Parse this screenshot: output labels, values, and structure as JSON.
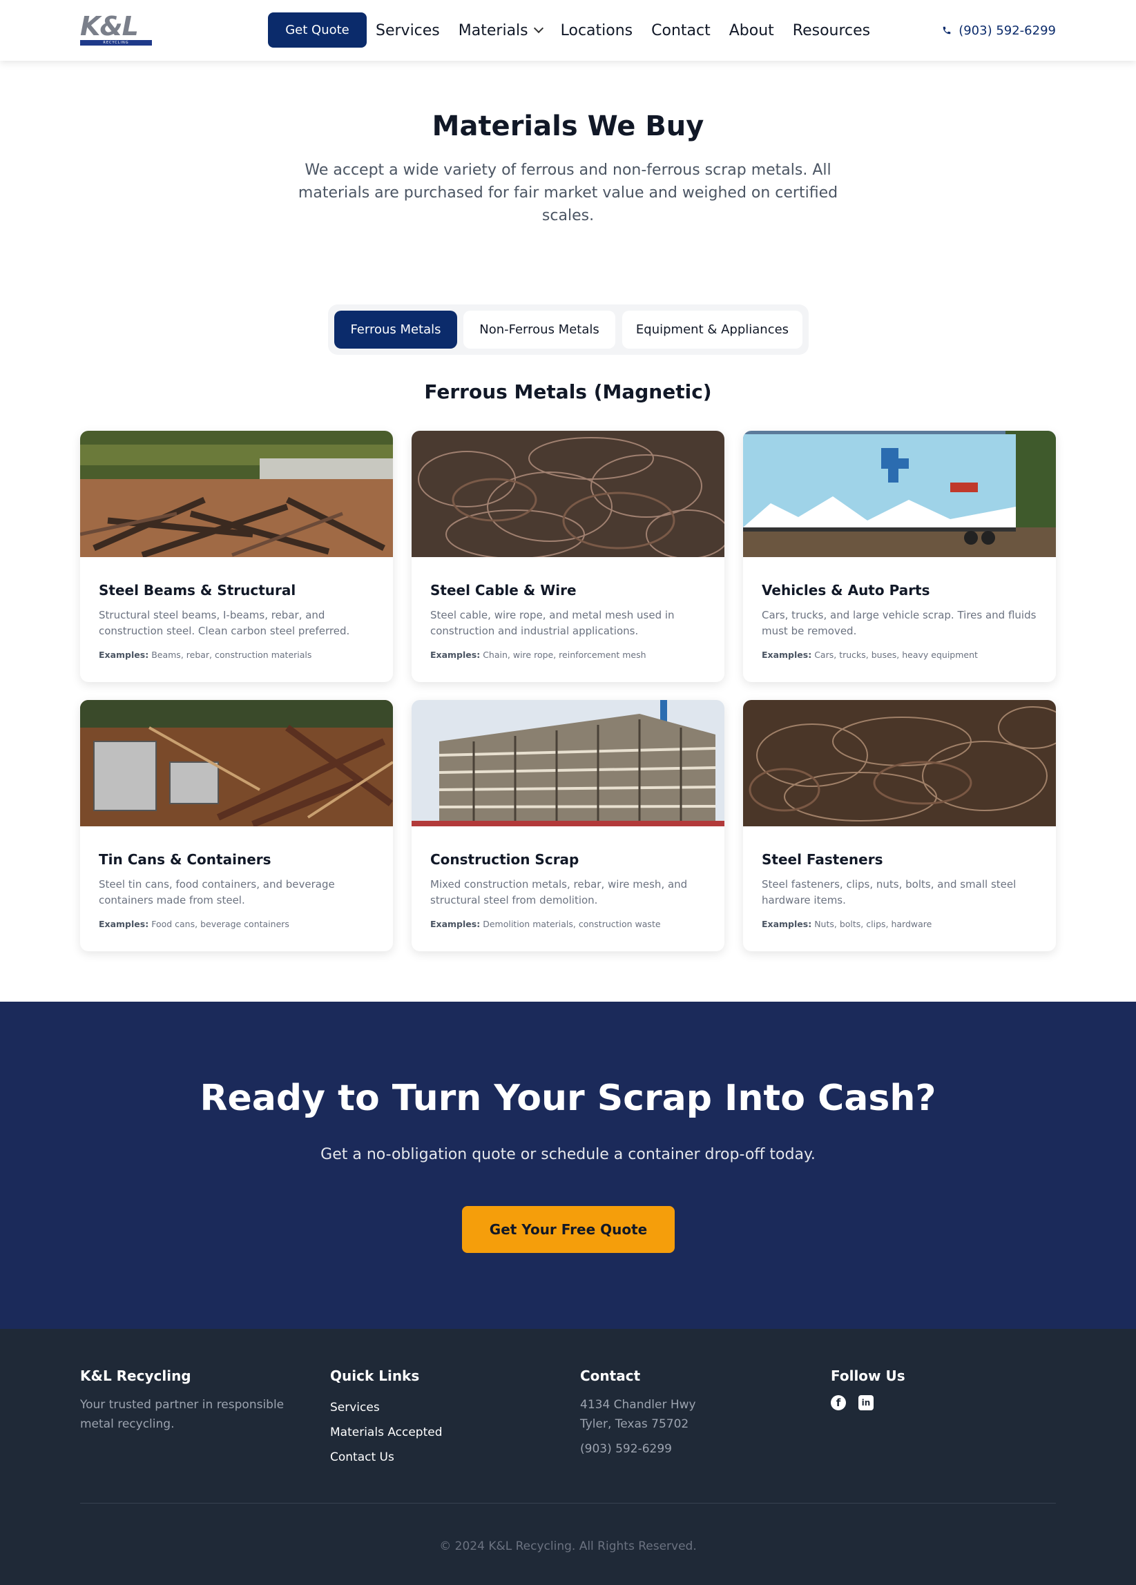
{
  "header": {
    "logo": {
      "text": "K&L",
      "sub": "RECYCLING"
    },
    "quote_button": "Get Quote",
    "nav": [
      "Services",
      "Materials",
      "Locations",
      "Contact",
      "About",
      "Resources"
    ],
    "phone": "(903) 592-6299",
    "phone_icon": "phone-icon"
  },
  "hero": {
    "title": "Materials We Buy",
    "subtitle": "We accept a wide variety of ferrous and non-ferrous scrap metals. All materials are purchased for fair market value and weighed on certified scales."
  },
  "tabs": {
    "items": [
      "Ferrous Metals",
      "Non-Ferrous Metals",
      "Equipment & Appliances"
    ],
    "active": "Ferrous Metals"
  },
  "section_title": "Ferrous Metals (Magnetic)",
  "examples_label": "Examples:",
  "cards": [
    {
      "title": "Steel Beams & Structural",
      "desc": "Structural steel beams, I-beams, rebar, and construction steel. Clean carbon steel preferred.",
      "examples": "Beams, rebar, construction materials"
    },
    {
      "title": "Steel Cable & Wire",
      "desc": "Steel cable, wire rope, and metal mesh used in construction and industrial applications.",
      "examples": "Chain, wire rope, reinforcement mesh"
    },
    {
      "title": "Vehicles & Auto Parts",
      "desc": "Cars, trucks, and large vehicle scrap. Tires and fluids must be removed.",
      "examples": "Cars, trucks, buses, heavy equipment"
    },
    {
      "title": "Tin Cans & Containers",
      "desc": "Steel tin cans, food containers, and beverage containers made from steel.",
      "examples": "Food cans, beverage containers"
    },
    {
      "title": "Construction Scrap",
      "desc": "Mixed construction metals, rebar, wire mesh, and structural steel from demolition.",
      "examples": "Demolition materials, construction waste"
    },
    {
      "title": "Steel Fasteners",
      "desc": "Steel fasteners, clips, nuts, bolts, and small steel hardware items.",
      "examples": "Nuts, bolts, clips, hardware"
    }
  ],
  "cta": {
    "title": "Ready to Turn Your Scrap Into Cash?",
    "subtitle": "Get a no-obligation quote or schedule a container drop-off today.",
    "button": "Get Your Free Quote"
  },
  "footer": {
    "brand": {
      "title": "K&L Recycling",
      "text": "Your trusted partner in responsible metal recycling."
    },
    "quick_links": {
      "title": "Quick Links",
      "items": [
        "Services",
        "Materials Accepted",
        "Contact Us"
      ]
    },
    "contact": {
      "title": "Contact",
      "address1": "4134 Chandler Hwy",
      "address2": "Tyler, Texas 75702",
      "phone": "(903) 592-6299"
    },
    "follow": {
      "title": "Follow Us",
      "icons": [
        "facebook-icon",
        "linkedin-icon"
      ]
    },
    "copyright": "© 2024 K&L Recycling. All Rights Reserved."
  },
  "colors": {
    "primary": "#0b2b6b",
    "cta_bg": "#1b2a5a",
    "accent": "#f59e0b",
    "footer_bg": "#1f2937"
  }
}
